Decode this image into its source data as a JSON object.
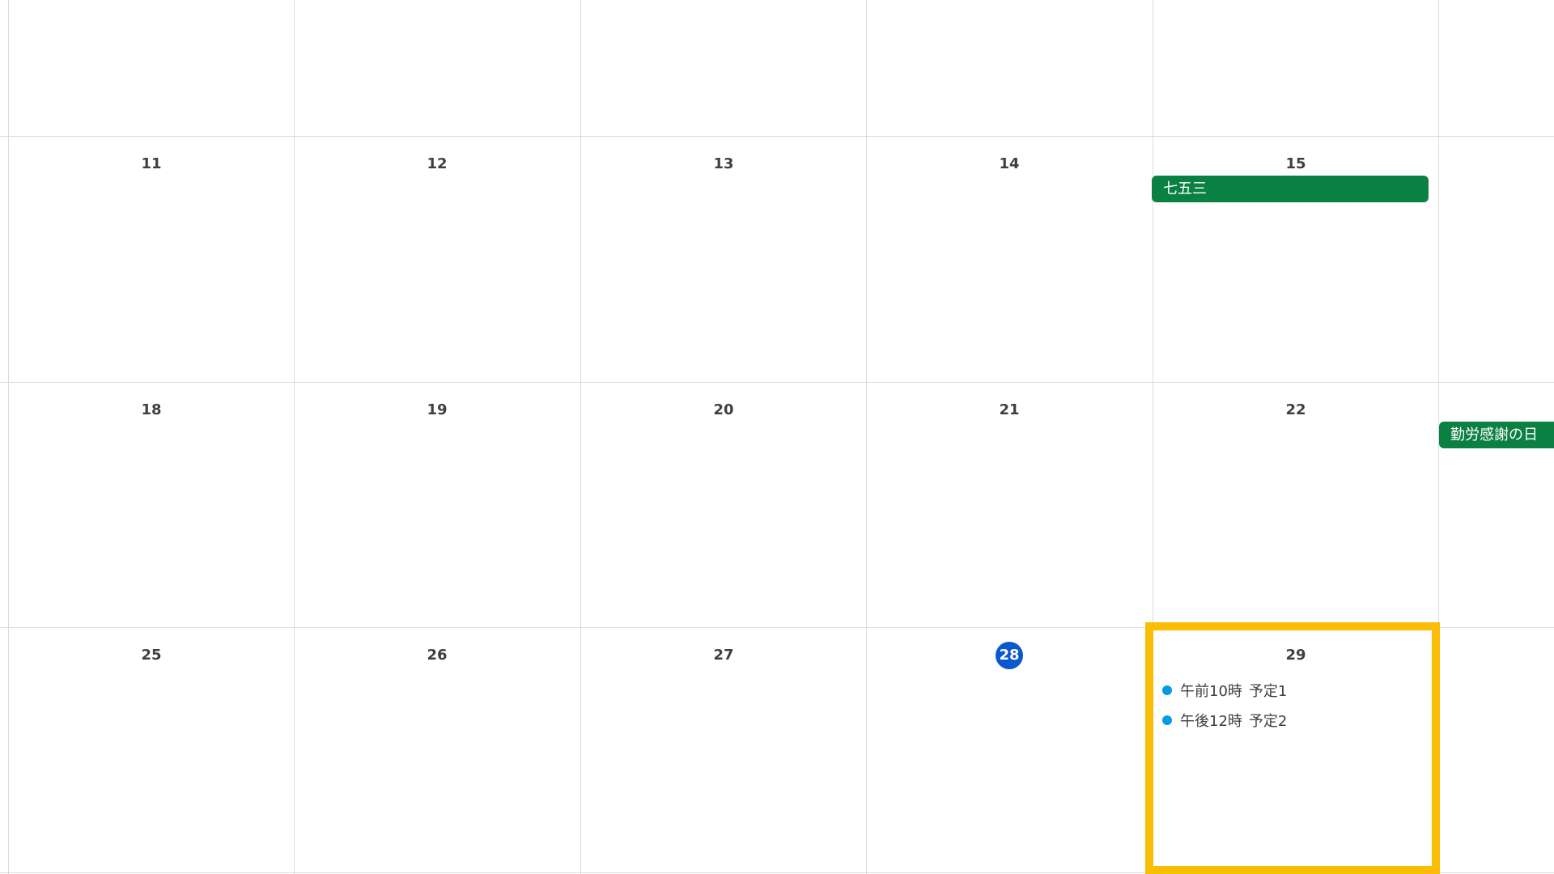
{
  "weeks": [
    {
      "days": [
        "",
        "",
        "",
        "",
        "",
        ""
      ]
    },
    {
      "days": [
        "11",
        "12",
        "13",
        "14",
        "15",
        ""
      ]
    },
    {
      "days": [
        "18",
        "19",
        "20",
        "21",
        "22",
        ""
      ]
    },
    {
      "days": [
        "25",
        "26",
        "27",
        "28",
        "29",
        ""
      ]
    }
  ],
  "today": "28",
  "colors": {
    "today": "#0b57d0",
    "holiday": "#0b8043",
    "event_dot": "#039be5",
    "highlight": "#fbbc04",
    "grid": "#dadce0"
  },
  "all_day_events": [
    {
      "title": "七五三",
      "day": "15"
    },
    {
      "title": "勤労感謝の日",
      "day": "23"
    }
  ],
  "timed_events": [
    {
      "time": "午前10時",
      "title": "予定1",
      "day": "29"
    },
    {
      "time": "午後12時",
      "title": "予定2",
      "day": "29"
    }
  ],
  "selected_day": "29"
}
